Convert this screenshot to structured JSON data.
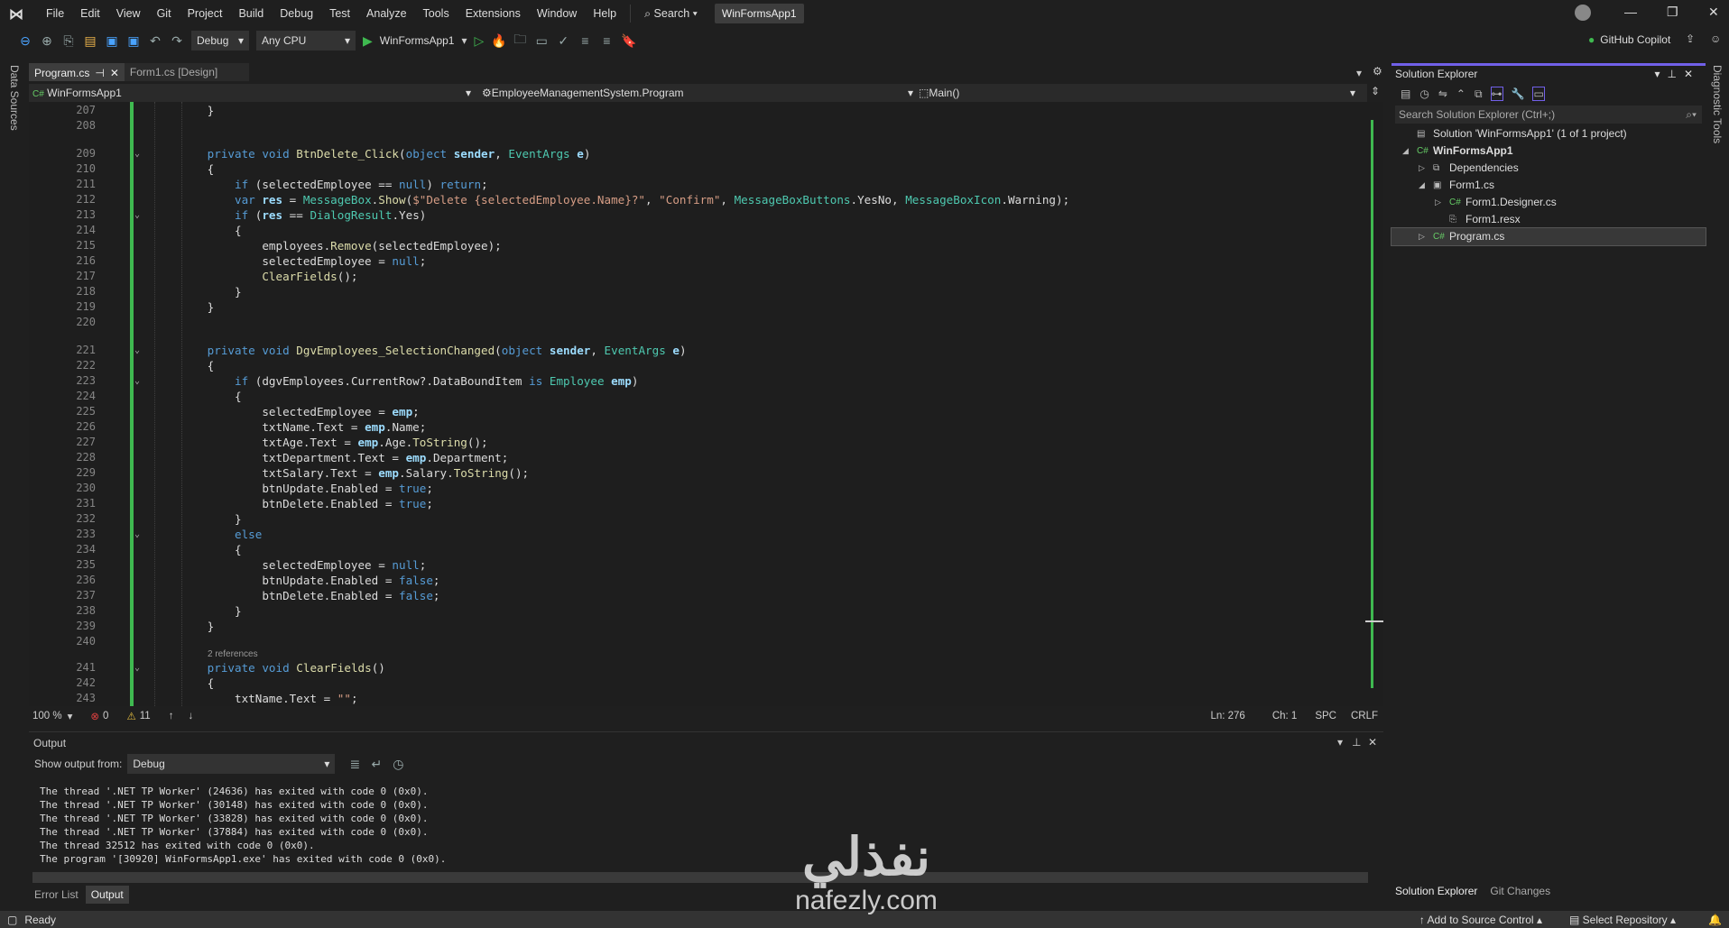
{
  "menubar": {
    "items": [
      "File",
      "Edit",
      "View",
      "Git",
      "Project",
      "Build",
      "Debug",
      "Test",
      "Analyze",
      "Tools",
      "Extensions",
      "Window",
      "Help"
    ],
    "search": "Search",
    "title": "WinFormsApp1"
  },
  "toolbar": {
    "config": "Debug",
    "platform": "Any CPU",
    "run_target": "WinFormsApp1",
    "copilot": "GitHub Copilot"
  },
  "side_left": "Data Sources",
  "side_right": "Diagnostic Tools",
  "tabs": [
    {
      "label": "Program.cs",
      "active": true
    },
    {
      "label": "Form1.cs [Design]",
      "active": false
    }
  ],
  "navbar": {
    "project": "WinFormsApp1",
    "type": "EmployeeManagementSystem.Program",
    "member": "Main()"
  },
  "editor": {
    "lines": [
      {
        "n": "207",
        "code": "        }"
      },
      {
        "n": "208",
        "code": ""
      },
      {
        "n": "209",
        "code": "        private void BtnDelete_Click(object sender, EventArgs e)",
        "gap": true,
        "fold": true
      },
      {
        "n": "210",
        "code": "        {"
      },
      {
        "n": "211",
        "code": "            if (selectedEmployee == null) return;"
      },
      {
        "n": "212",
        "code": "            var res = MessageBox.Show($\"Delete {selectedEmployee.Name}?\", \"Confirm\", MessageBoxButtons.YesNo, MessageBoxIcon.Warning);"
      },
      {
        "n": "213",
        "code": "            if (res == DialogResult.Yes)",
        "fold": true
      },
      {
        "n": "214",
        "code": "            {"
      },
      {
        "n": "215",
        "code": "                employees.Remove(selectedEmployee);"
      },
      {
        "n": "216",
        "code": "                selectedEmployee = null;"
      },
      {
        "n": "217",
        "code": "                ClearFields();"
      },
      {
        "n": "218",
        "code": "            }"
      },
      {
        "n": "219",
        "code": "        }"
      },
      {
        "n": "220",
        "code": ""
      },
      {
        "n": "221",
        "code": "        private void DgvEmployees_SelectionChanged(object sender, EventArgs e)",
        "gap": true,
        "fold": true
      },
      {
        "n": "222",
        "code": "        {"
      },
      {
        "n": "223",
        "code": "            if (dgvEmployees.CurrentRow?.DataBoundItem is Employee emp)",
        "fold": true
      },
      {
        "n": "224",
        "code": "            {"
      },
      {
        "n": "225",
        "code": "                selectedEmployee = emp;"
      },
      {
        "n": "226",
        "code": "                txtName.Text = emp.Name;"
      },
      {
        "n": "227",
        "code": "                txtAge.Text = emp.Age.ToString();"
      },
      {
        "n": "228",
        "code": "                txtDepartment.Text = emp.Department;"
      },
      {
        "n": "229",
        "code": "                txtSalary.Text = emp.Salary.ToString();"
      },
      {
        "n": "230",
        "code": "                btnUpdate.Enabled = true;"
      },
      {
        "n": "231",
        "code": "                btnDelete.Enabled = true;"
      },
      {
        "n": "232",
        "code": "            }"
      },
      {
        "n": "233",
        "code": "            else",
        "fold": true
      },
      {
        "n": "234",
        "code": "            {"
      },
      {
        "n": "235",
        "code": "                selectedEmployee = null;"
      },
      {
        "n": "236",
        "code": "                btnUpdate.Enabled = false;"
      },
      {
        "n": "237",
        "code": "                btnDelete.Enabled = false;"
      },
      {
        "n": "238",
        "code": "            }"
      },
      {
        "n": "239",
        "code": "        }"
      },
      {
        "n": "240",
        "code": ""
      },
      {
        "n": "241",
        "code": "        private void ClearFields()",
        "lens": "2 references",
        "fold": true
      },
      {
        "n": "242",
        "code": "        {"
      },
      {
        "n": "243",
        "code": "            txtName.Text = \"\";"
      }
    ],
    "zoom": "100 %",
    "errors": "0",
    "warnings": "11",
    "ln": "Ln: 276",
    "ch": "Ch: 1",
    "spacing": "SPC",
    "eol": "CRLF"
  },
  "output": {
    "title": "Output",
    "show_from_label": "Show output from:",
    "source": "Debug",
    "lines": [
      "The thread '.NET TP Worker' (24636) has exited with code 0 (0x0).",
      "The thread '.NET TP Worker' (30148) has exited with code 0 (0x0).",
      "The thread '.NET TP Worker' (33828) has exited with code 0 (0x0).",
      "The thread '.NET TP Worker' (37884) has exited with code 0 (0x0).",
      "The thread 32512 has exited with code 0 (0x0).",
      "The program '[30920] WinFormsApp1.exe' has exited with code 0 (0x0)."
    ],
    "tabs": [
      "Error List",
      "Output"
    ]
  },
  "solution_explorer": {
    "title": "Solution Explorer",
    "search_placeholder": "Search Solution Explorer (Ctrl+;)",
    "items": [
      {
        "label": "Solution 'WinFormsApp1' (1 of 1 project)",
        "icon": "solution-icon"
      },
      {
        "label": "WinFormsApp1",
        "icon": "csharp-project-icon"
      },
      {
        "label": "Dependencies",
        "icon": "dependencies-icon"
      },
      {
        "label": "Form1.cs",
        "icon": "form-icon"
      },
      {
        "label": "Form1.Designer.cs",
        "icon": "csharp-file-icon"
      },
      {
        "label": "Form1.resx",
        "icon": "resx-icon"
      },
      {
        "label": "Program.cs",
        "icon": "csharp-file-icon",
        "selected": true
      }
    ],
    "tabs": [
      "Solution Explorer",
      "Git Changes"
    ]
  },
  "statusbar": {
    "ready": "Ready",
    "source_control": "Add to Source Control",
    "repository": "Select Repository"
  },
  "watermark": {
    "arabic": "نفذلي",
    "latin": "nafezly.com"
  }
}
